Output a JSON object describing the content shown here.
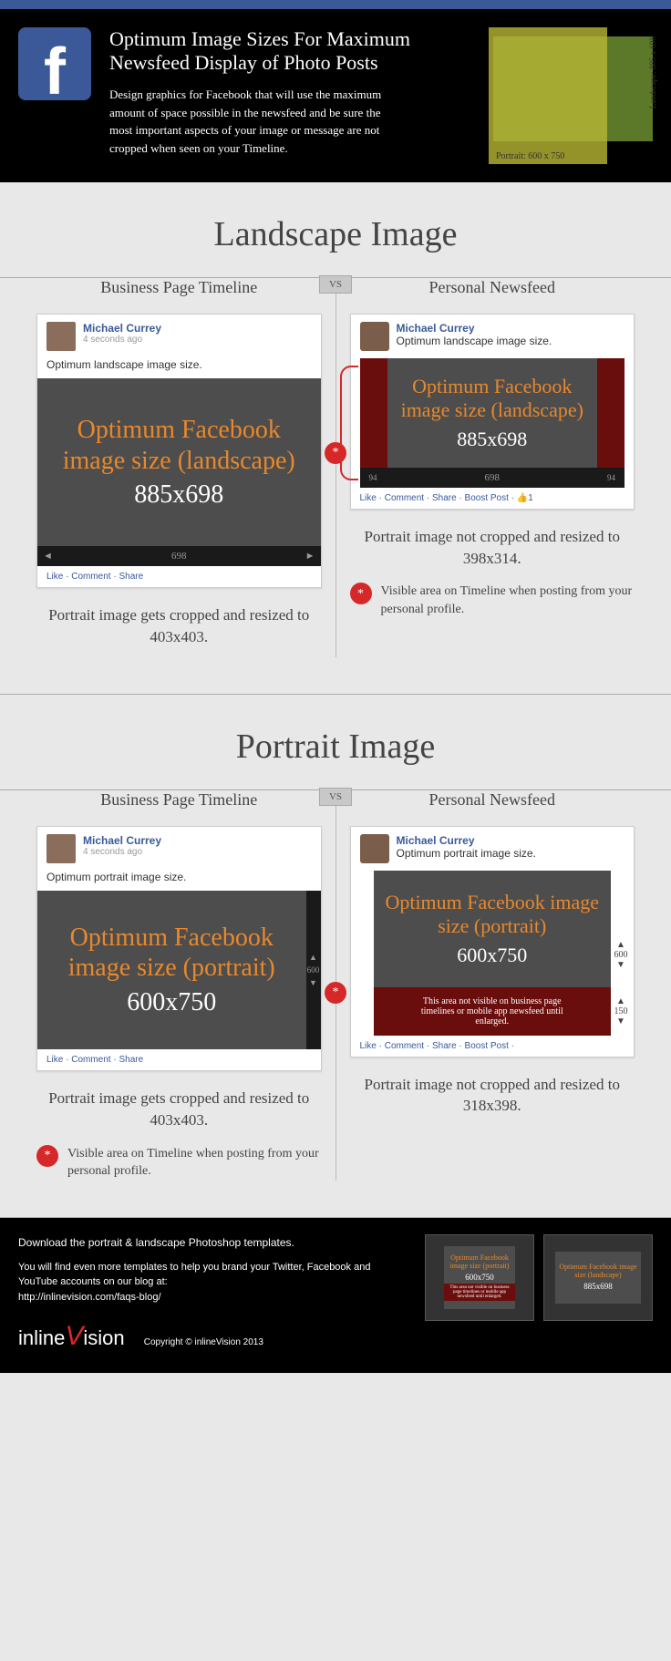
{
  "header": {
    "title": "Optimum Image Sizes For Maximum Newsfeed Display of Photo Posts",
    "desc": "Design graphics for Facebook that will use the maximum amount of space possible in the newsfeed and be sure the most important aspects of your image or message are not cropped when seen on your Timeline.",
    "diag_land": "Landscape: 885 x 698",
    "diag_port": "Portrait: 600 x 750"
  },
  "landscape": {
    "title": "Landscape Image",
    "left_title": "Business Page Timeline",
    "right_title": "Personal Newsfeed",
    "vs": "VS",
    "author": "Michael Currey",
    "time": "4 seconds ago",
    "caption": "Optimum landscape image size.",
    "img_title": "Optimum Facebook image size (landscape)",
    "img_dims": "885x698",
    "width_label": "698",
    "side_label": "94",
    "actions1": "Like · Comment · Share",
    "actions2": "Like · Comment · Share · Boost Post · 👍1",
    "left_caption": "Portrait image gets cropped and resized to 403x403.",
    "right_caption": "Portrait image not cropped and resized to 398x314.",
    "star_note": "Visible area on Timeline when posting from your personal profile."
  },
  "portrait": {
    "title": "Portrait Image",
    "left_title": "Business Page Timeline",
    "right_title": "Personal Newsfeed",
    "vs": "VS",
    "author": "Michael Currey",
    "time": "4 seconds ago",
    "caption": "Optimum portrait image size.",
    "img_title": "Optimum Facebook image size (portrait)",
    "img_dims": "600x750",
    "height_label": "600",
    "extra_label": "150",
    "hidden_text": "This area not visible on business page timelines or mobile app newsfeed until enlarged.",
    "actions1": "Like · Comment · Share",
    "actions2": "Like · Comment · Share · Boost Post ·",
    "left_caption": "Portrait image gets cropped and resized to 403x403.",
    "right_caption": "Portrait image not cropped and resized to 318x398.",
    "star_note": "Visible area on Timeline when posting from your personal profile."
  },
  "footer": {
    "dl": "Download the portrait & landscape Photoshop templates.",
    "desc": "You will find even more templates to help you brand your Twitter, Facebook and YouTube accounts on our blog at:",
    "url": "http://inlinevision.com/faqs-blog/",
    "copyright": "Copyright © inlineVision 2013",
    "thumb1_t": "Optimum Facebook image size (portrait)",
    "thumb1_d": "600x750",
    "thumb2_t": "Optimum Facebook image size (landscape)",
    "thumb2_d": "885x698"
  },
  "star": "*",
  "arrows": {
    "l": "◄",
    "r": "►",
    "u": "▲",
    "d": "▼"
  }
}
